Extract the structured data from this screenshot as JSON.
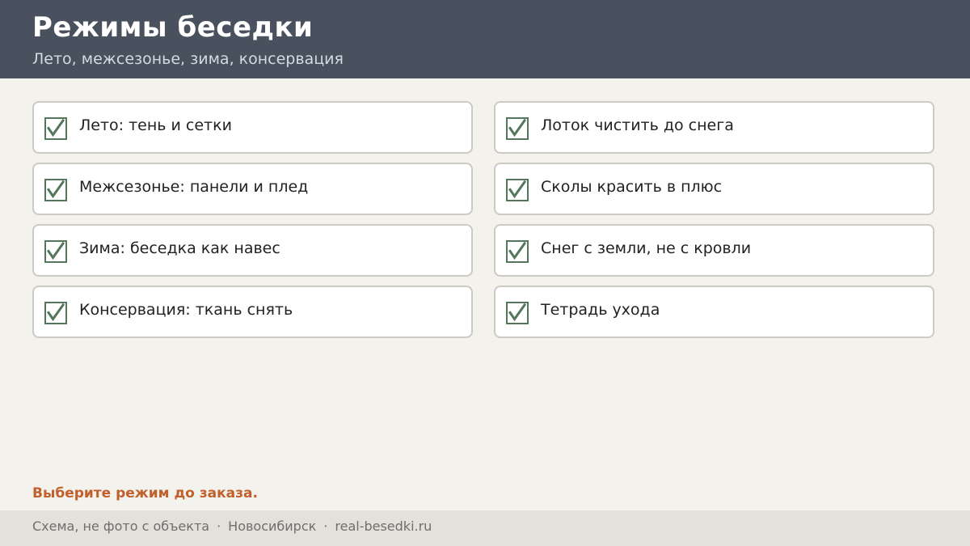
{
  "header": {
    "title": "Режимы беседки",
    "subtitle": "Лето, межсезонье, зима, консервация"
  },
  "checklist": {
    "check_color": "#52775a",
    "items": [
      {
        "label": "Лето: тень и сетки",
        "checked": true,
        "icon": "checkbox-checked-icon"
      },
      {
        "label": "Межсезонье: панели и плед",
        "checked": true,
        "icon": "checkbox-checked-icon"
      },
      {
        "label": "Зима: беседка как навес",
        "checked": true,
        "icon": "checkbox-checked-icon"
      },
      {
        "label": "Консервация: ткань снять",
        "checked": true,
        "icon": "checkbox-checked-icon"
      },
      {
        "label": "Лоток чистить до снега",
        "checked": true,
        "icon": "checkbox-checked-icon"
      },
      {
        "label": "Сколы красить в плюс",
        "checked": true,
        "icon": "checkbox-checked-icon"
      },
      {
        "label": "Снег с земли, не с кровли",
        "checked": true,
        "icon": "checkbox-checked-icon"
      },
      {
        "label": "Тетрадь ухода",
        "checked": true,
        "icon": "checkbox-checked-icon"
      }
    ]
  },
  "callout": {
    "text": "Выберите режим до заказа.",
    "color": "#c0602c"
  },
  "footer": {
    "note": "Схема, не фото с объекта",
    "separator": "·",
    "city": "Новосибирск",
    "site": "real-besedki.ru"
  },
  "colors": {
    "header_bg": "#48515d",
    "page_bg": "#f4f2ed",
    "footer_bg": "#e4e1da"
  }
}
